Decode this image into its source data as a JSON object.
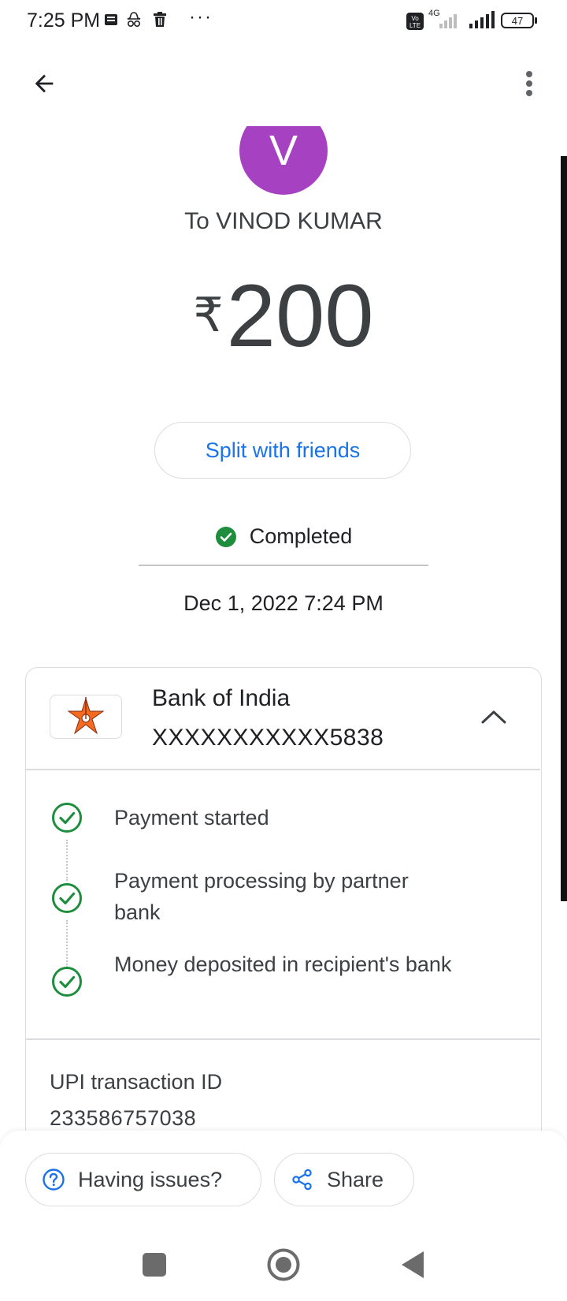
{
  "status_bar": {
    "time": "7:25 PM",
    "more_dots": "···",
    "battery": "47",
    "network": "4G"
  },
  "recipient": {
    "avatar_letter": "V",
    "avatar_color": "#a642c2",
    "label": "To VINOD KUMAR"
  },
  "payment": {
    "currency": "₹",
    "amount": "200",
    "split_label": "Split with friends",
    "status": "Completed",
    "status_color": "#1e8e3e",
    "datetime": "Dec 1, 2022 7:24 PM"
  },
  "bank": {
    "name": "Bank of India",
    "account": "XXXXXXXXXXX5838",
    "logo_icon": "bank-of-india-star-logo"
  },
  "steps": [
    {
      "label": "Payment started"
    },
    {
      "label": "Payment processing by partner bank"
    },
    {
      "label": "Money deposited in recipient's bank"
    }
  ],
  "upi": {
    "label": "UPI transaction ID",
    "value": "233586757038"
  },
  "actions": {
    "issues_label": "Having issues?",
    "share_label": "Share"
  },
  "colors": {
    "accent": "#1a73e8",
    "success": "#1e8e3e"
  }
}
